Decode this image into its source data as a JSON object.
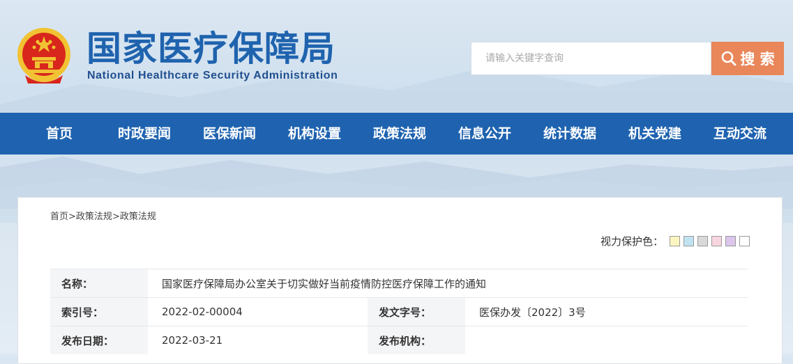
{
  "site": {
    "title_cn": "国家医疗保障局",
    "title_en": "National Healthcare Security Administration"
  },
  "search": {
    "placeholder": "请输入关键字查询",
    "button_label": "搜 索"
  },
  "nav": {
    "items": [
      "首页",
      "时政要闻",
      "医保新闻",
      "机构设置",
      "政策法规",
      "信息公开",
      "统计数据",
      "机关党建",
      "互动交流"
    ]
  },
  "breadcrumb": {
    "items": [
      "首页",
      "政策法规",
      "政策法规"
    ],
    "separator": ">"
  },
  "eye_protection": {
    "label": "视力保护色：",
    "colors": [
      "#fbf5c0",
      "#bfe3f1",
      "#d9d9d9",
      "#f7d6df",
      "#dcc6ec",
      "#ffffff"
    ]
  },
  "document": {
    "name_label": "名称：",
    "name_value": "国家医疗保障局办公室关于切实做好当前疫情防控医疗保障工作的通知",
    "index_label": "索引号：",
    "index_value": "2022-02-00004",
    "doc_no_label": "发文字号：",
    "doc_no_value": "医保办发〔2022〕3号",
    "date_label": "发布日期：",
    "date_value": "2022-03-21",
    "org_label": "发布机构：",
    "org_value": ""
  },
  "colors": {
    "brand_blue": "#1f63ae",
    "nav_blue": "#1f63b0",
    "search_orange": "#e9875a",
    "emblem_red": "#d8261c",
    "emblem_gold": "#f1c232"
  }
}
